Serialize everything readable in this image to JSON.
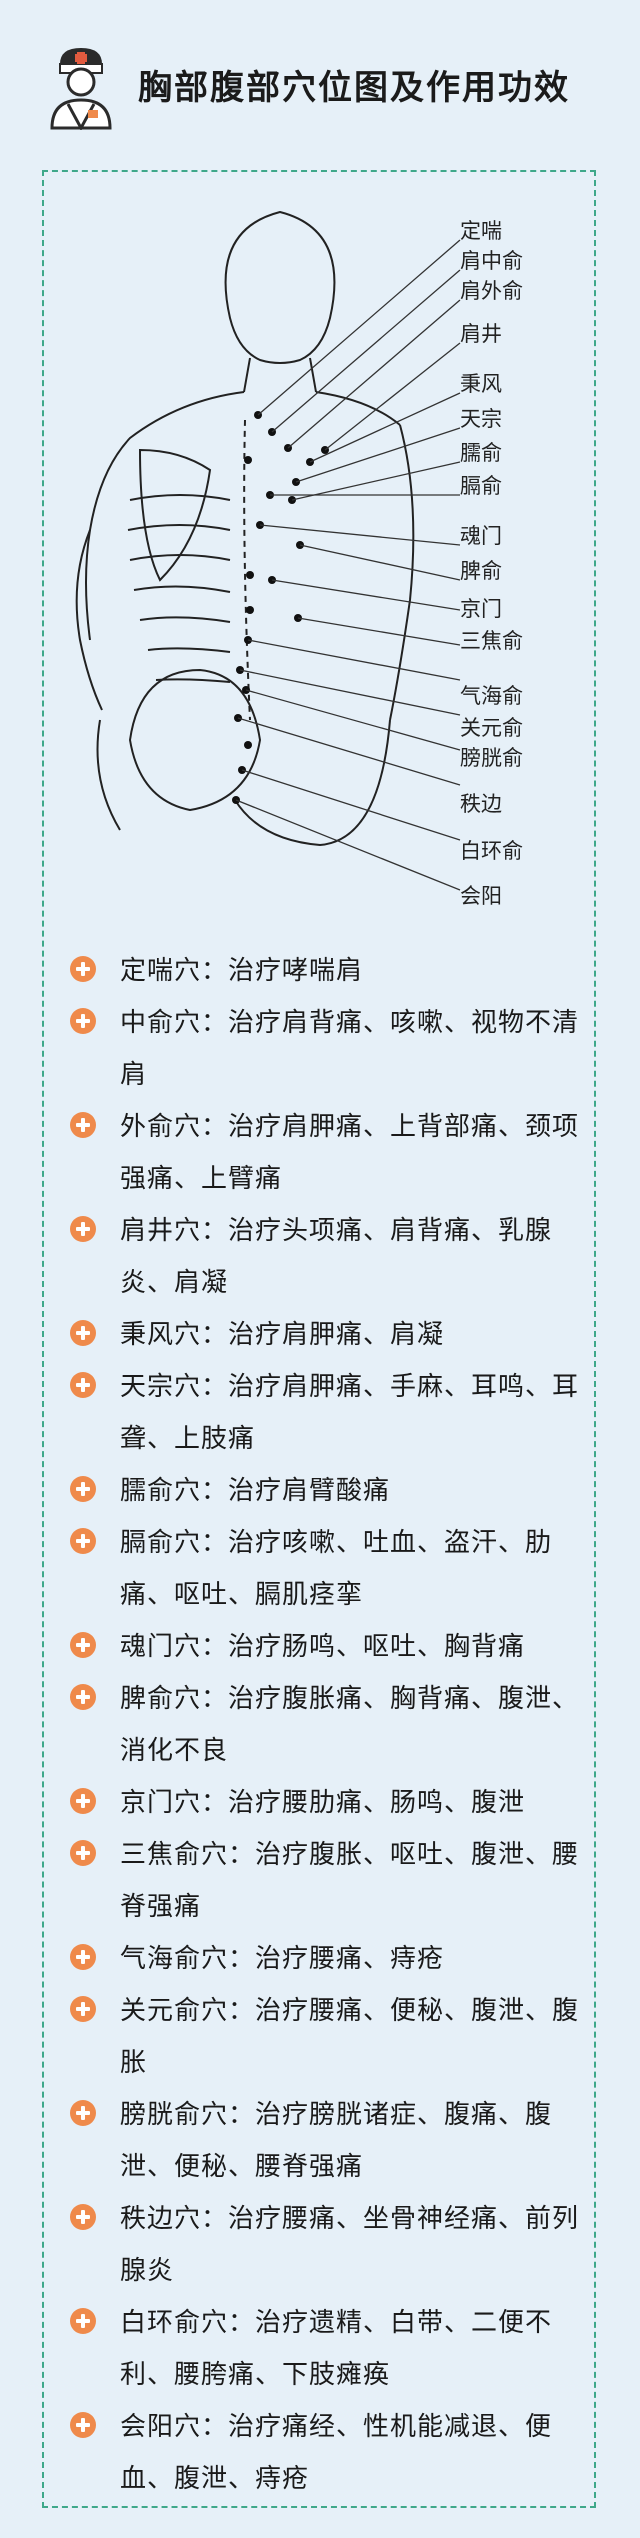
{
  "title": "胸部腹部穴位图及作用功效",
  "colors": {
    "background": "#e6f0f8",
    "frame": "#3fa88a",
    "bullet": "#ef8a4b"
  },
  "header": {
    "icon": "doctor-icon"
  },
  "diagram": {
    "labels": [
      "定喘",
      "肩中俞",
      "肩外俞",
      "肩井",
      "秉风",
      "天宗",
      "臑俞",
      "膈俞",
      "魂门",
      "脾俞",
      "京门",
      "三焦俞",
      "气海俞",
      "关元俞",
      "膀胱俞",
      "秩边",
      "白环俞",
      "会阳"
    ]
  },
  "items": [
    {
      "name": "定喘穴",
      "desc": "治疗哮喘肩"
    },
    {
      "name": "中俞穴",
      "desc": "治疗肩背痛、咳嗽、视物不清肩"
    },
    {
      "name": "外俞穴",
      "desc": "治疗肩胛痛、上背部痛、颈项强痛、上臂痛"
    },
    {
      "name": "肩井穴",
      "desc": "治疗头项痛、肩背痛、乳腺炎、肩凝"
    },
    {
      "name": "秉风穴",
      "desc": "治疗肩胛痛、肩凝"
    },
    {
      "name": "天宗穴",
      "desc": "治疗肩胛痛、手麻、耳鸣、耳聋、上肢痛"
    },
    {
      "name": "臑俞穴",
      "desc": "治疗肩臂酸痛"
    },
    {
      "name": "膈俞穴",
      "desc": "治疗咳嗽、吐血、盗汗、肋痛、呕吐、膈肌痉挛"
    },
    {
      "name": "魂门穴",
      "desc": "治疗肠鸣、呕吐、胸背痛"
    },
    {
      "name": "脾俞穴",
      "desc": "治疗腹胀痛、胸背痛、腹泄、消化不良"
    },
    {
      "name": "京门穴",
      "desc": "治疗腰肋痛、肠鸣、腹泄"
    },
    {
      "name": "三焦俞穴",
      "desc": "治疗腹胀、呕吐、腹泄、腰脊强痛"
    },
    {
      "name": "气海俞穴",
      "desc": "治疗腰痛、痔疮"
    },
    {
      "name": "关元俞穴",
      "desc": "治疗腰痛、便秘、腹泄、腹胀"
    },
    {
      "name": "膀胱俞穴",
      "desc": "治疗膀胱诸症、腹痛、腹泄、便秘、腰脊强痛"
    },
    {
      "name": "秩边穴",
      "desc": "治疗腰痛、坐骨神经痛、前列腺炎"
    },
    {
      "name": "白环俞穴",
      "desc": "治疗遗精、白带、二便不利、腰胯痛、下肢瘫痪"
    },
    {
      "name": "会阳穴",
      "desc": "治疗痛经、性机能减退、便血、腹泄、痔疮"
    }
  ]
}
